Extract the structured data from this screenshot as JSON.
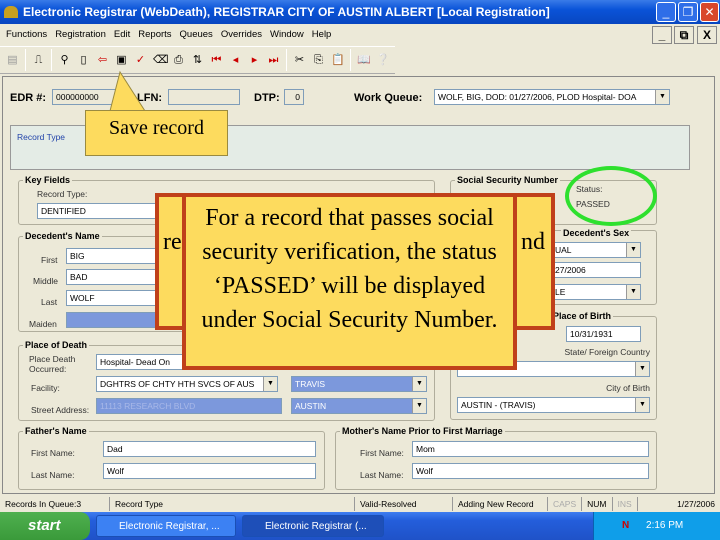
{
  "window": {
    "title": "Electronic Registrar (WebDeath), REGISTRAR   CITY OF AUSTIN   ALBERT   [Local Registration]"
  },
  "menu": [
    "Functions",
    "Registration",
    "Edit",
    "Reports",
    "Queues",
    "Overrides",
    "Window",
    "Help"
  ],
  "header": {
    "edr_label": "EDR #:",
    "edr_value": "000000000",
    "lfn_label": "LFN:",
    "dtp_label": "DTP:",
    "dtp_value": "0",
    "work_queue_label": "Work Queue:",
    "work_queue_value": "WOLF, BIG, DOD: 01/27/2006, PLOD  Hospital- DOA"
  },
  "record_type_panel": {
    "label": "Record Type"
  },
  "key_fields": {
    "title": "Key Fields",
    "record_type_label": "Record Type:",
    "record_type_value": "DENTIFIED"
  },
  "decedent_name": {
    "title": "Decedent's Name",
    "first_label": "First",
    "first": "BIG",
    "middle_label": "Middle",
    "middle": "BAD",
    "last_label": "Last",
    "last": "WOLF",
    "maiden_label": "Maiden"
  },
  "place_of_death": {
    "title": "Place of Death",
    "place_label": "Place Death Occurred:",
    "place": "Hospital- Dead On",
    "facility_label": "Facility:",
    "facility": "DGHTRS OF CHTY HTH SVCS OF AUS",
    "county": "TRAVIS",
    "street_label": "Street Address:",
    "street": "11113 RESEARCH BLVD",
    "city": "AUSTIN"
  },
  "ssn": {
    "title": "Social Security Number",
    "status_label": "Status:",
    "status": "PASSED"
  },
  "sex": {
    "title": "Decedent's Sex",
    "value": "UAL",
    "dod": "27/2006",
    "third": "LE"
  },
  "birth": {
    "title": "Place of Birth",
    "dob": "10/31/1931",
    "state_label": "State/ Foreign Country",
    "city_label": "City of Birth",
    "city": "AUSTIN - (TRAVIS)"
  },
  "father": {
    "title": "Father's Name",
    "first_label": "First Name:",
    "first": "Dad",
    "last_label": "Last Name:",
    "last": "Wolf"
  },
  "mother": {
    "title": "Mother's Name Prior to First Marriage",
    "first_label": "First Name:",
    "first": "Mom",
    "last_label": "Last Name:",
    "last": "Wolf"
  },
  "statusbar": [
    "Records In Queue:3",
    "Record Type",
    "Valid-Resolved",
    "Adding New Record",
    "CAPS",
    "NUM",
    "INS",
    "1/27/2006"
  ],
  "taskbar": {
    "start": "start",
    "tasks": [
      "Electronic Registrar, ...",
      "Electronic Registrar (..."
    ],
    "clock": "2:16 PM"
  },
  "callouts": {
    "save": "Save record",
    "hidden_left": "re",
    "hidden_right": "nd",
    "main": "For a record that passes social security verification, the status ‘PASSED’ will be displayed under Social Security Number."
  },
  "colors": {
    "highlight_circle": "#2ee02e",
    "callout_fill": "#fddb5e",
    "callout_border": "#c0401a"
  }
}
